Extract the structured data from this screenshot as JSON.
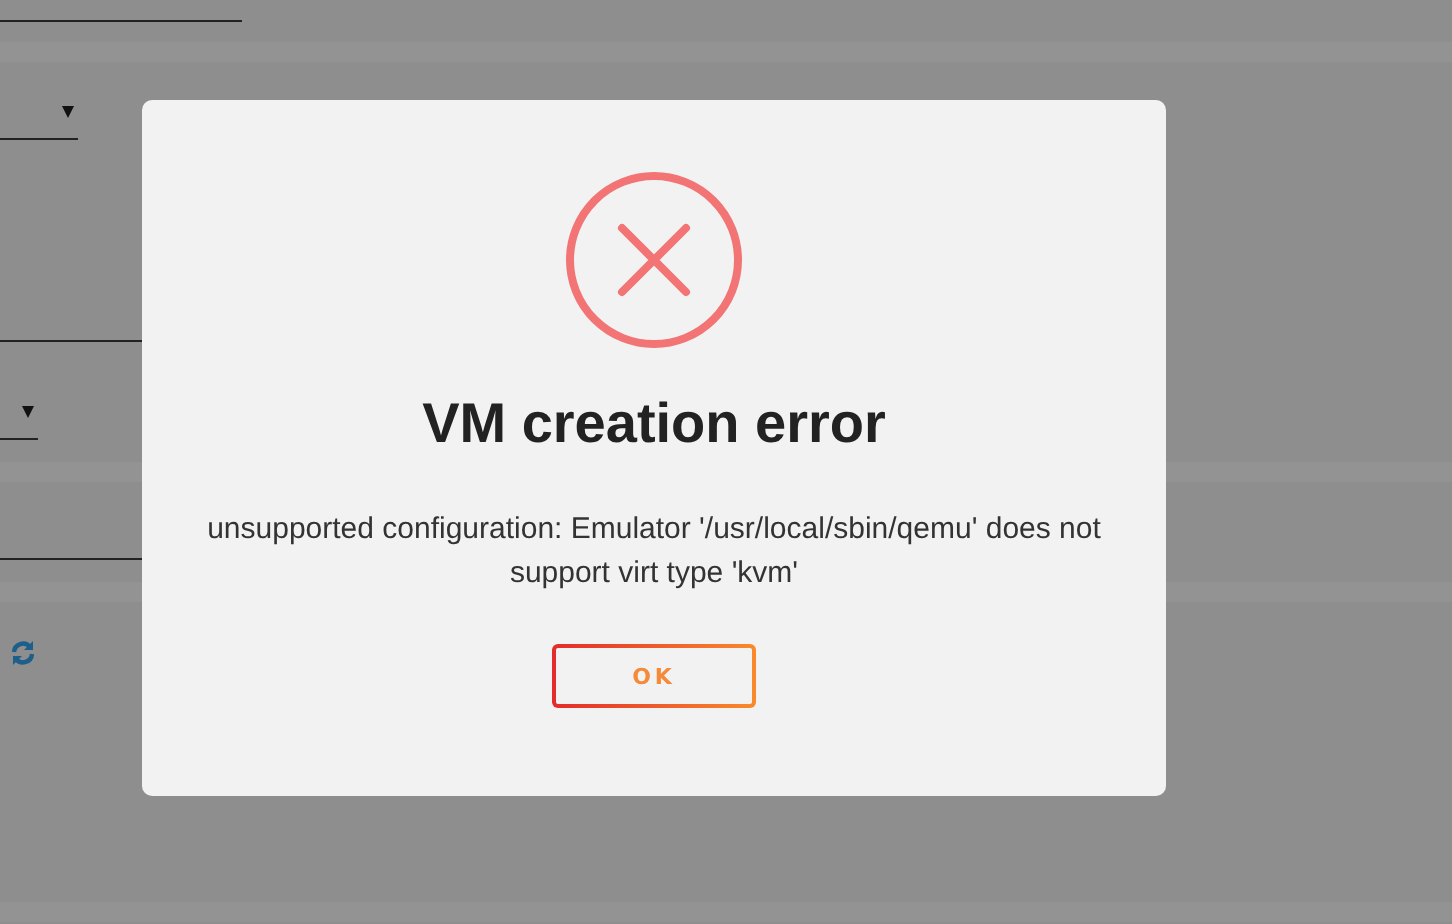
{
  "dialog": {
    "kind": "error",
    "title": "VM creation error",
    "message": "unsupported configuration: Emulator '/usr/local/sbin/qemu' does not support virt type 'kvm'",
    "buttons": [
      {
        "label": "OK"
      }
    ]
  }
}
